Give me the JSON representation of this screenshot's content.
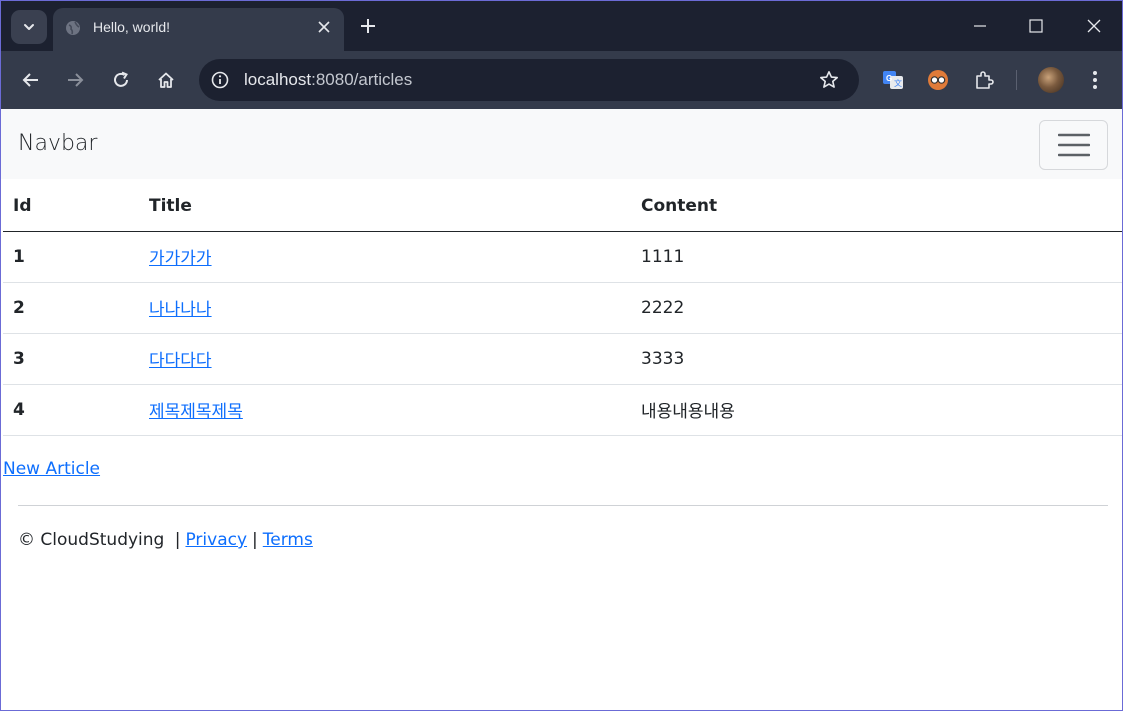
{
  "browser": {
    "tab_title": "Hello, world!",
    "url_host": "localhost",
    "url_path": ":8080/articles"
  },
  "page": {
    "brand": "Navbar",
    "table": {
      "headers": [
        "Id",
        "Title",
        "Content"
      ],
      "rows": [
        {
          "id": "1",
          "title": "가가가가",
          "content": "1111"
        },
        {
          "id": "2",
          "title": "나나나나",
          "content": "2222"
        },
        {
          "id": "3",
          "title": "다다다다",
          "content": "3333"
        },
        {
          "id": "4",
          "title": "제목제목제목",
          "content": "내용내용내용"
        }
      ]
    },
    "new_article_label": "New Article",
    "footer": {
      "copyright": "© CloudStudying",
      "separator": "|",
      "privacy": "Privacy",
      "terms": "Terms"
    }
  },
  "colors": {
    "link": "#0d6efd",
    "navbar_bg": "#f8f9fa",
    "chrome_dark": "#1c2130",
    "chrome_mid": "#343b4b"
  },
  "icons": [
    "tab-search-icon",
    "globe-icon",
    "close-icon",
    "plus-icon",
    "minimize-icon",
    "maximize-icon",
    "back-icon",
    "forward-icon",
    "reload-icon",
    "home-icon",
    "info-icon",
    "star-icon",
    "translate-icon",
    "extension-glasses-icon",
    "puzzle-icon",
    "menu-dots-icon",
    "hamburger-icon"
  ]
}
